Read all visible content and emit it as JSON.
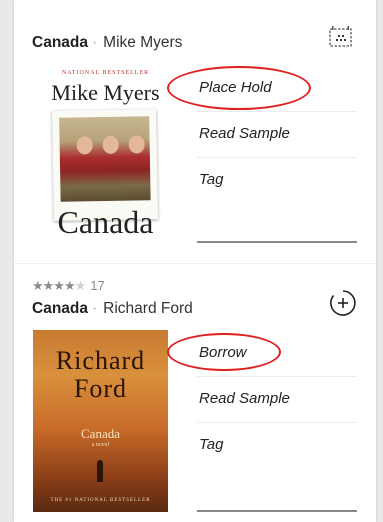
{
  "book1": {
    "title": "Canada",
    "author": "Mike Myers",
    "cover": {
      "banner": "NATIONAL BESTSELLER",
      "author": "Mike Myers",
      "title": "Canada"
    },
    "actions": [
      "Place Hold",
      "Read Sample",
      "Tag"
    ],
    "icon": "calendar-icon"
  },
  "book2": {
    "rating": 4,
    "rating_count": "17",
    "title": "Canada",
    "author": "Richard Ford",
    "cover": {
      "author_line1": "Richard",
      "author_line2": "Ford",
      "title": "Canada",
      "subtitle": "a novel",
      "footer": "THE #1 NATIONAL BESTSELLER"
    },
    "actions": [
      "Borrow",
      "Read Sample",
      "Tag"
    ],
    "icon": "add-icon"
  },
  "highlight_color": "#e02020"
}
